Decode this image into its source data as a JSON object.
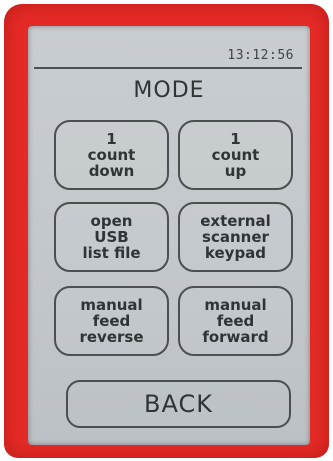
{
  "status_bar": {
    "time": "13:12:56"
  },
  "screen": {
    "title": "MODE"
  },
  "buttons": [
    {
      "label": "1\ncount\ndown"
    },
    {
      "label": "1\ncount\nup"
    },
    {
      "label": "open\nUSB\nlist file"
    },
    {
      "label": "external\nscanner\nkeypad"
    },
    {
      "label": "manual\nfeed\nreverse"
    },
    {
      "label": "manual\nfeed\nforward"
    }
  ],
  "back_button": {
    "label": "BACK"
  },
  "colors": {
    "bezel": "#e42a26",
    "lcd_background": "#c3c8cc",
    "lcd_text": "#2f3436"
  }
}
